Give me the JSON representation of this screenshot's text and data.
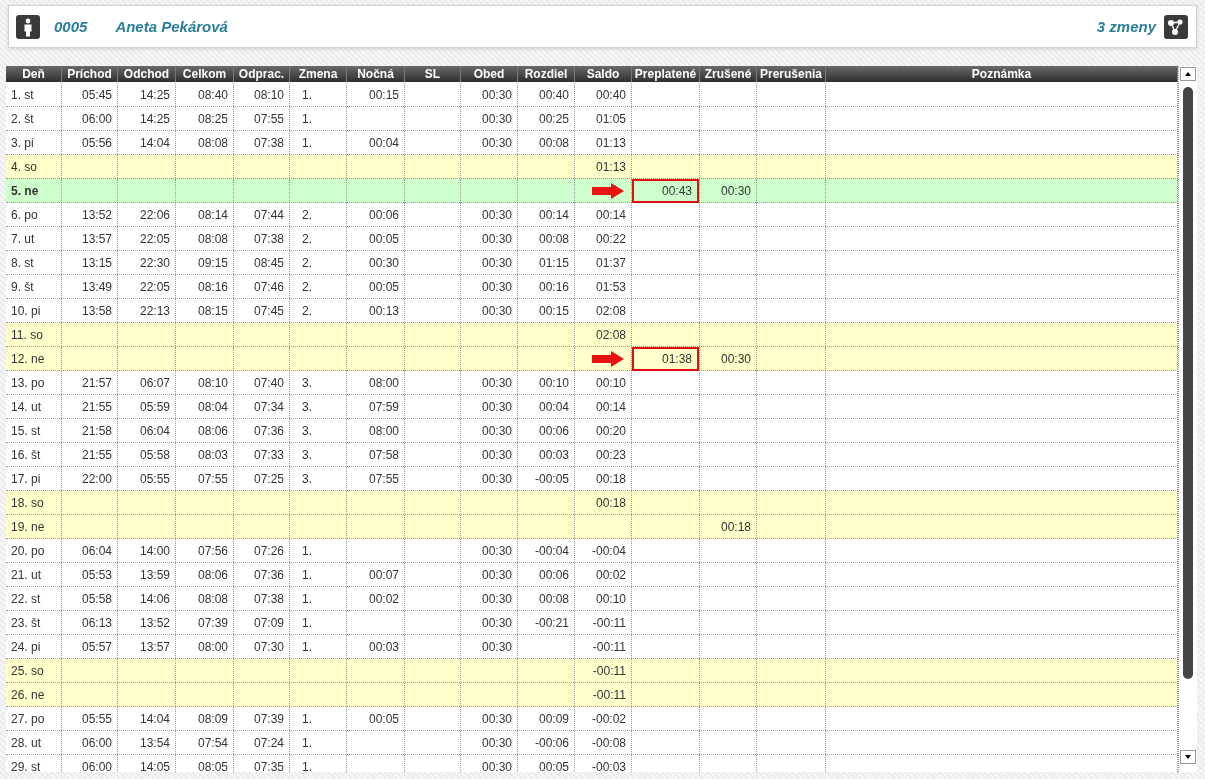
{
  "employee": {
    "number": "0005",
    "name": "Aneta Pekárová",
    "shifts": "3 zmeny"
  },
  "table": {
    "columns": [
      {
        "label": "Deň",
        "kind": "text"
      },
      {
        "label": "Príchod",
        "kind": "time"
      },
      {
        "label": "Odchod",
        "kind": "time"
      },
      {
        "label": "Celkom",
        "kind": "time"
      },
      {
        "label": "Odprac.",
        "kind": "time"
      },
      {
        "label": "Zmena",
        "kind": "text"
      },
      {
        "label": "Nočná",
        "kind": "time"
      },
      {
        "label": "SL",
        "kind": "time"
      },
      {
        "label": "Obed",
        "kind": "time"
      },
      {
        "label": "Rozdiel",
        "kind": "time"
      },
      {
        "label": "Saldo",
        "kind": "time"
      },
      {
        "label": "Preplatené",
        "kind": "time"
      },
      {
        "label": "Zrušené",
        "kind": "time"
      },
      {
        "label": "Prerušenia",
        "kind": "time"
      },
      {
        "label": "Poznámka",
        "kind": "text"
      }
    ],
    "rows": [
      {
        "kind": "workday",
        "marked": false,
        "cells": [
          "1. st",
          "05:45",
          "14:25",
          "08:40",
          "08:10",
          "1.",
          "00:15",
          null,
          "00:30",
          "00:40",
          "00:40",
          null,
          null,
          null,
          null
        ]
      },
      {
        "kind": "workday",
        "marked": false,
        "cells": [
          "2. št",
          "06:00",
          "14:25",
          "08:25",
          "07:55",
          "1.",
          null,
          null,
          "00:30",
          "00:25",
          "01:05",
          null,
          null,
          null,
          null
        ]
      },
      {
        "kind": "workday",
        "marked": false,
        "cells": [
          "3. pi",
          "05:56",
          "14:04",
          "08:08",
          "07:38",
          "1.",
          "00:04",
          null,
          "00:30",
          "00:08",
          "01:13",
          null,
          null,
          null,
          null
        ]
      },
      {
        "kind": "weekend",
        "marked": false,
        "cells": [
          "4. so",
          null,
          null,
          null,
          null,
          null,
          null,
          null,
          null,
          null,
          "01:13",
          null,
          null,
          null,
          null
        ]
      },
      {
        "kind": "highlighted",
        "marked": true,
        "cells": [
          "5. ne",
          null,
          null,
          null,
          null,
          null,
          null,
          null,
          null,
          null,
          null,
          "00:43",
          "00:30",
          null,
          null
        ]
      },
      {
        "kind": "workday",
        "marked": false,
        "cells": [
          "6. po",
          "13:52",
          "22:06",
          "08:14",
          "07:44",
          "2.",
          "00:06",
          null,
          "00:30",
          "00:14",
          "00:14",
          null,
          null,
          null,
          null
        ]
      },
      {
        "kind": "workday",
        "marked": false,
        "cells": [
          "7. ut",
          "13:57",
          "22:05",
          "08:08",
          "07:38",
          "2.",
          "00:05",
          null,
          "00:30",
          "00:08",
          "00:22",
          null,
          null,
          null,
          null
        ]
      },
      {
        "kind": "workday",
        "marked": false,
        "cells": [
          "8. st",
          "13:15",
          "22:30",
          "09:15",
          "08:45",
          "2.",
          "00:30",
          null,
          "00:30",
          "01:15",
          "01:37",
          null,
          null,
          null,
          null
        ]
      },
      {
        "kind": "workday",
        "marked": false,
        "cells": [
          "9. št",
          "13:49",
          "22:05",
          "08:16",
          "07:46",
          "2.",
          "00:05",
          null,
          "00:30",
          "00:16",
          "01:53",
          null,
          null,
          null,
          null
        ]
      },
      {
        "kind": "workday",
        "marked": false,
        "cells": [
          "10. pi",
          "13:58",
          "22:13",
          "08:15",
          "07:45",
          "2.",
          "00:13",
          null,
          "00:30",
          "00:15",
          "02:08",
          null,
          null,
          null,
          null
        ]
      },
      {
        "kind": "weekend",
        "marked": false,
        "cells": [
          "11. so",
          null,
          null,
          null,
          null,
          null,
          null,
          null,
          null,
          null,
          "02:08",
          null,
          null,
          null,
          null
        ]
      },
      {
        "kind": "weekend",
        "marked": true,
        "cells": [
          "12. ne",
          null,
          null,
          null,
          null,
          null,
          null,
          null,
          null,
          null,
          null,
          "01:38",
          "00:30",
          null,
          null
        ]
      },
      {
        "kind": "workday",
        "marked": false,
        "cells": [
          "13. po",
          "21:57",
          "06:07",
          "08:10",
          "07:40",
          "3.",
          "08:00",
          null,
          "00:30",
          "00:10",
          "00:10",
          null,
          null,
          null,
          null
        ]
      },
      {
        "kind": "workday",
        "marked": false,
        "cells": [
          "14. ut",
          "21:55",
          "05:59",
          "08:04",
          "07:34",
          "3.",
          "07:59",
          null,
          "00:30",
          "00:04",
          "00:14",
          null,
          null,
          null,
          null
        ]
      },
      {
        "kind": "workday",
        "marked": false,
        "cells": [
          "15. st",
          "21:58",
          "06:04",
          "08:06",
          "07:36",
          "3.",
          "08:00",
          null,
          "00:30",
          "00:06",
          "00:20",
          null,
          null,
          null,
          null
        ]
      },
      {
        "kind": "workday",
        "marked": false,
        "cells": [
          "16. št",
          "21:55",
          "05:58",
          "08:03",
          "07:33",
          "3.",
          "07:58",
          null,
          "00:30",
          "00:03",
          "00:23",
          null,
          null,
          null,
          null
        ]
      },
      {
        "kind": "workday",
        "marked": false,
        "cells": [
          "17. pi",
          "22:00",
          "05:55",
          "07:55",
          "07:25",
          "3.",
          "07:55",
          null,
          "00:30",
          "-00:05",
          "00:18",
          null,
          null,
          null,
          null
        ]
      },
      {
        "kind": "weekend",
        "marked": false,
        "cells": [
          "18. so",
          null,
          null,
          null,
          null,
          null,
          null,
          null,
          null,
          null,
          "00:18",
          null,
          null,
          null,
          null
        ]
      },
      {
        "kind": "weekend",
        "marked": false,
        "cells": [
          "19. ne",
          null,
          null,
          null,
          null,
          null,
          null,
          null,
          null,
          null,
          null,
          null,
          "00:18",
          null,
          null
        ]
      },
      {
        "kind": "workday",
        "marked": false,
        "cells": [
          "20. po",
          "06:04",
          "14:00",
          "07:56",
          "07:26",
          "1.",
          null,
          null,
          "00:30",
          "-00:04",
          "-00:04",
          null,
          null,
          null,
          null
        ]
      },
      {
        "kind": "workday",
        "marked": false,
        "cells": [
          "21. ut",
          "05:53",
          "13:59",
          "08:06",
          "07:36",
          "1.",
          "00:07",
          null,
          "00:30",
          "00:06",
          "00:02",
          null,
          null,
          null,
          null
        ]
      },
      {
        "kind": "workday",
        "marked": false,
        "cells": [
          "22. st",
          "05:58",
          "14:06",
          "08:08",
          "07:38",
          "1.",
          "00:02",
          null,
          "00:30",
          "00:08",
          "00:10",
          null,
          null,
          null,
          null
        ]
      },
      {
        "kind": "workday",
        "marked": false,
        "cells": [
          "23. št",
          "06:13",
          "13:52",
          "07:39",
          "07:09",
          "1.",
          null,
          null,
          "00:30",
          "-00:21",
          "-00:11",
          null,
          null,
          null,
          null
        ]
      },
      {
        "kind": "workday",
        "marked": false,
        "cells": [
          "24. pi",
          "05:57",
          "13:57",
          "08:00",
          "07:30",
          "1.",
          "00:03",
          null,
          "00:30",
          null,
          "-00:11",
          null,
          null,
          null,
          null
        ]
      },
      {
        "kind": "weekend",
        "marked": false,
        "cells": [
          "25. so",
          null,
          null,
          null,
          null,
          null,
          null,
          null,
          null,
          null,
          "-00:11",
          null,
          null,
          null,
          null
        ]
      },
      {
        "kind": "weekend",
        "marked": false,
        "cells": [
          "26. ne",
          null,
          null,
          null,
          null,
          null,
          null,
          null,
          null,
          null,
          "-00:11",
          null,
          null,
          null,
          null
        ]
      },
      {
        "kind": "workday",
        "marked": false,
        "cells": [
          "27. po",
          "05:55",
          "14:04",
          "08:09",
          "07:39",
          "1.",
          "00:05",
          null,
          "00:30",
          "00:09",
          "-00:02",
          null,
          null,
          null,
          null
        ]
      },
      {
        "kind": "workday",
        "marked": false,
        "cells": [
          "28. ut",
          "06:00",
          "13:54",
          "07:54",
          "07:24",
          "1.",
          null,
          null,
          "00:30",
          "-00:06",
          "-00:08",
          null,
          null,
          null,
          null
        ]
      },
      {
        "kind": "workday",
        "marked": false,
        "cells": [
          "29. st",
          "06:00",
          "14:05",
          "08:05",
          "07:35",
          "1.",
          null,
          null,
          "00:30",
          "00:05",
          "-00:03",
          null,
          null,
          null,
          null
        ]
      }
    ]
  }
}
